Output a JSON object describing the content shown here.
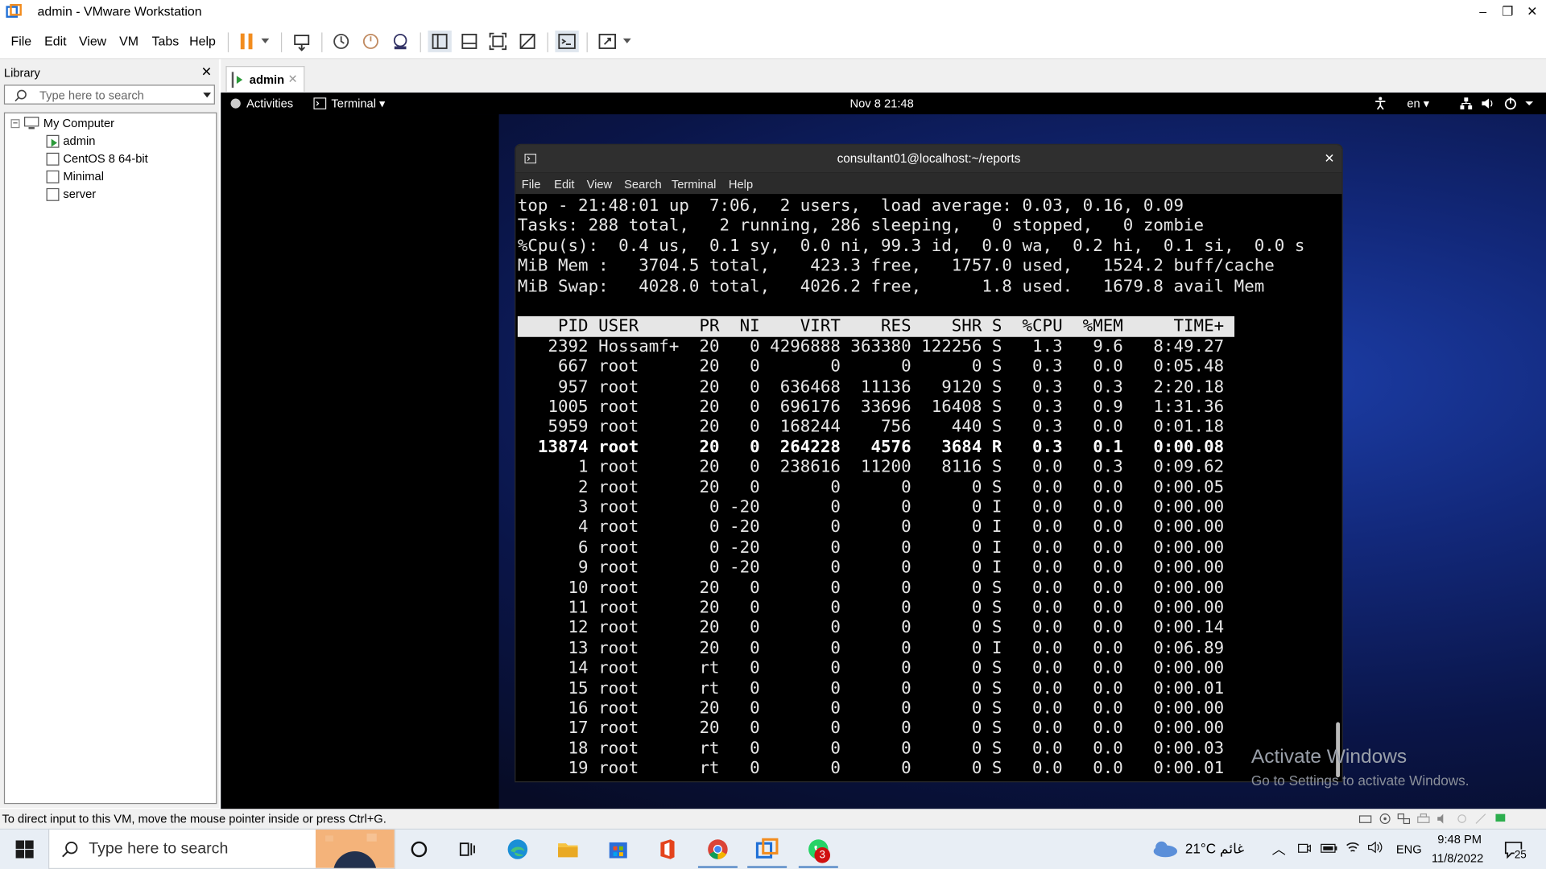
{
  "window": {
    "title": "admin - VMware Workstation",
    "controls": [
      "–",
      "❐",
      "✕"
    ]
  },
  "menu": [
    "File",
    "Edit",
    "View",
    "VM",
    "Tabs",
    "Help"
  ],
  "library": {
    "title": "Library",
    "close": "✕",
    "search_placeholder": "Type here to search",
    "root": "My Computer",
    "items": [
      "admin",
      "CentOS 8 64-bit",
      "Minimal",
      "server"
    ]
  },
  "tab": {
    "label": "admin",
    "close": "✕"
  },
  "gnome": {
    "activities": "Activities",
    "app": "Terminal ▾",
    "clock": "Nov 8  21:48",
    "lang": "en ▾"
  },
  "terminal": {
    "title": "consultant01@localhost:~/reports",
    "close": "✕",
    "menu": [
      "File",
      "Edit",
      "View",
      "Search",
      "Terminal",
      "Help"
    ],
    "summary": [
      "top - 21:48:01 up  7:06,  2 users,  load average: 0.03, 0.16, 0.09",
      "Tasks: 288 total,   2 running, 286 sleeping,   0 stopped,   0 zombie",
      "%Cpu(s):  0.4 us,  0.1 sy,  0.0 ni, 99.3 id,  0.0 wa,  0.2 hi,  0.1 si,  0.0 s",
      "MiB Mem :   3704.5 total,    423.3 free,   1757.0 used,   1524.2 buff/cache",
      "MiB Swap:   4028.0 total,   4026.2 free,      1.8 used.   1679.8 avail Mem"
    ],
    "header": "    PID USER      PR  NI    VIRT    RES    SHR S  %CPU  %MEM     TIME+ ",
    "rows": [
      "   2392 Hossamf+  20   0 4296888 363380 122256 S   1.3   9.6   8:49.27",
      "    667 root      20   0       0      0      0 S   0.3   0.0   0:05.48",
      "    957 root      20   0  636468  11136   9120 S   0.3   0.3   2:20.18",
      "   1005 root      20   0  696176  33696  16408 S   0.3   0.9   1:31.36",
      "   5959 root      20   0  168244    756    440 S   0.3   0.0   0:01.18",
      "  13874 root      20   0  264228   4576   3684 R   0.3   0.1   0:00.08",
      "      1 root      20   0  238616  11200   8116 S   0.0   0.3   0:09.62",
      "      2 root      20   0       0      0      0 S   0.0   0.0   0:00.05",
      "      3 root       0 -20       0      0      0 I   0.0   0.0   0:00.00",
      "      4 root       0 -20       0      0      0 I   0.0   0.0   0:00.00",
      "      6 root       0 -20       0      0      0 I   0.0   0.0   0:00.00",
      "      9 root       0 -20       0      0      0 I   0.0   0.0   0:00.00",
      "     10 root      20   0       0      0      0 S   0.0   0.0   0:00.00",
      "     11 root      20   0       0      0      0 S   0.0   0.0   0:00.00",
      "     12 root      20   0       0      0      0 S   0.0   0.0   0:00.14",
      "     13 root      20   0       0      0      0 I   0.0   0.0   0:06.89",
      "     14 root      rt   0       0      0      0 S   0.0   0.0   0:00.00",
      "     15 root      rt   0       0      0      0 S   0.0   0.0   0:00.01",
      "     16 root      20   0       0      0      0 S   0.0   0.0   0:00.00",
      "     17 root      20   0       0      0      0 S   0.0   0.0   0:00.00",
      "     18 root      rt   0       0      0      0 S   0.0   0.0   0:00.03",
      "     19 root      rt   0       0      0      0 S   0.0   0.0   0:00.01"
    ]
  },
  "watermark": {
    "line1": "Activate Windows",
    "line2": "Go to Settings to activate Windows."
  },
  "status": "To direct input to this VM, move the mouse pointer inside or press Ctrl+G.",
  "taskbar": {
    "search_placeholder": "Type here to search",
    "weather": "21°C  غائم",
    "lang": "ENG",
    "time": "9:48 PM",
    "date": "11/8/2022",
    "notif_count": "25",
    "whatsapp_badge": "3"
  },
  "colors": {
    "vmware_orange": "#f28c1e",
    "term_bg": "#000000",
    "desktop_blue": "#1c3ea8"
  }
}
